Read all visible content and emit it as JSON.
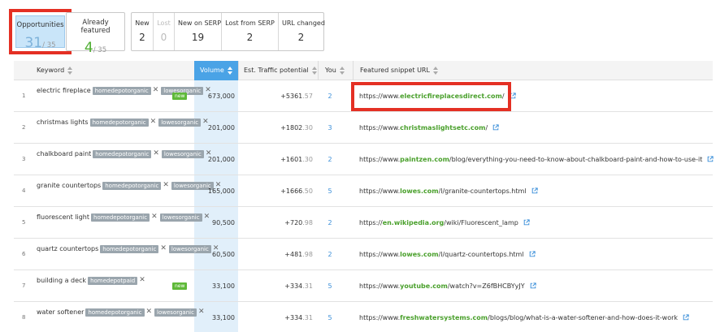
{
  "summary": {
    "opportunities": {
      "label": "Opportunities",
      "value": "31",
      "total": "/ 35"
    },
    "already_featured": {
      "label": "Already featured",
      "value": "4",
      "total": "/ 35"
    },
    "stats": [
      {
        "label": "New",
        "value": "2",
        "muted": false
      },
      {
        "label": "Lost",
        "value": "0",
        "muted": true
      },
      {
        "label": "New on SERP",
        "value": "19",
        "muted": false
      },
      {
        "label": "Lost from SERP",
        "value": "2",
        "muted": false
      },
      {
        "label": "URL changed",
        "value": "2",
        "muted": false
      }
    ]
  },
  "table": {
    "headers": {
      "keyword": "Keyword",
      "volume": "Volume",
      "traffic": "Est. Traffic potential",
      "you": "You",
      "url": "Featured snippet URL"
    },
    "rows": [
      {
        "num": "1",
        "keyword": "electric fireplace",
        "tags": [
          "homedepotorganic",
          "lowesorganic"
        ],
        "badge": "new",
        "volume": "673,000",
        "traffic_int": "+5361",
        "traffic_dec": ".57",
        "you": "2",
        "url_pre": "https://www.",
        "url_domain": "electricfireplacesdirect.com",
        "url_post": "/"
      },
      {
        "num": "2",
        "keyword": "christmas lights",
        "tags": [
          "homedepotorganic",
          "lowesorganic"
        ],
        "badge": "",
        "volume": "201,000",
        "traffic_int": "+1802",
        "traffic_dec": ".30",
        "you": "3",
        "url_pre": "https://www.",
        "url_domain": "christmaslightsetc.com",
        "url_post": "/"
      },
      {
        "num": "3",
        "keyword": "chalkboard paint",
        "tags": [
          "homedepotorganic",
          "lowesorganic"
        ],
        "badge": "",
        "volume": "201,000",
        "traffic_int": "+1601",
        "traffic_dec": ".30",
        "you": "2",
        "url_pre": "https://www.",
        "url_domain": "paintzen.com",
        "url_post": "/blog/everything-you-need-to-know-about-chalkboard-paint-and-how-to-use-it"
      },
      {
        "num": "4",
        "keyword": "granite countertops",
        "tags": [
          "homedepotorganic",
          "lowesorganic"
        ],
        "badge": "",
        "volume": "165,000",
        "traffic_int": "+1666",
        "traffic_dec": ".50",
        "you": "5",
        "url_pre": "https://www.",
        "url_domain": "lowes.com",
        "url_post": "/l/granite-countertops.html"
      },
      {
        "num": "5",
        "keyword": "fluorescent light",
        "tags": [
          "homedepotorganic",
          "lowesorganic"
        ],
        "badge": "",
        "volume": "90,500",
        "traffic_int": "+720",
        "traffic_dec": ".98",
        "you": "2",
        "url_pre": "https://",
        "url_domain": "en.wikipedia.org",
        "url_post": "/wiki/Fluorescent_lamp"
      },
      {
        "num": "6",
        "keyword": "quartz countertops",
        "tags": [
          "homedepotorganic",
          "lowesorganic"
        ],
        "badge": "",
        "volume": "60,500",
        "traffic_int": "+481",
        "traffic_dec": ".98",
        "you": "2",
        "url_pre": "https://www.",
        "url_domain": "lowes.com",
        "url_post": "/l/quartz-countertops.html"
      },
      {
        "num": "7",
        "keyword": "building a deck",
        "tags": [
          "homedepotpaid"
        ],
        "badge": "new",
        "volume": "33,100",
        "traffic_int": "+334",
        "traffic_dec": ".31",
        "you": "5",
        "url_pre": "https://www.",
        "url_domain": "youtube.com",
        "url_post": "/watch?v=Z6fBHCBYyJY"
      },
      {
        "num": "8",
        "keyword": "water softener",
        "tags": [
          "homedepotorganic",
          "lowesorganic"
        ],
        "badge": "",
        "volume": "33,100",
        "traffic_int": "+334",
        "traffic_dec": ".31",
        "you": "5",
        "url_pre": "https://www.",
        "url_domain": "freshwatersystems.com",
        "url_post": "/blogs/blog/what-is-a-water-softener-and-how-does-it-work"
      }
    ]
  },
  "colors": {
    "highlight": "#e43024",
    "active_header": "#4aa3e6",
    "volume_column": "#e1effa",
    "link": "#3b8fd9",
    "domain": "#4aa02c",
    "tag": "#9aa5ad",
    "new_badge": "#5fb939"
  },
  "icons": {
    "sort": "sort-arrows-icon",
    "external": "external-link-icon",
    "remove_tag": "close-icon"
  }
}
